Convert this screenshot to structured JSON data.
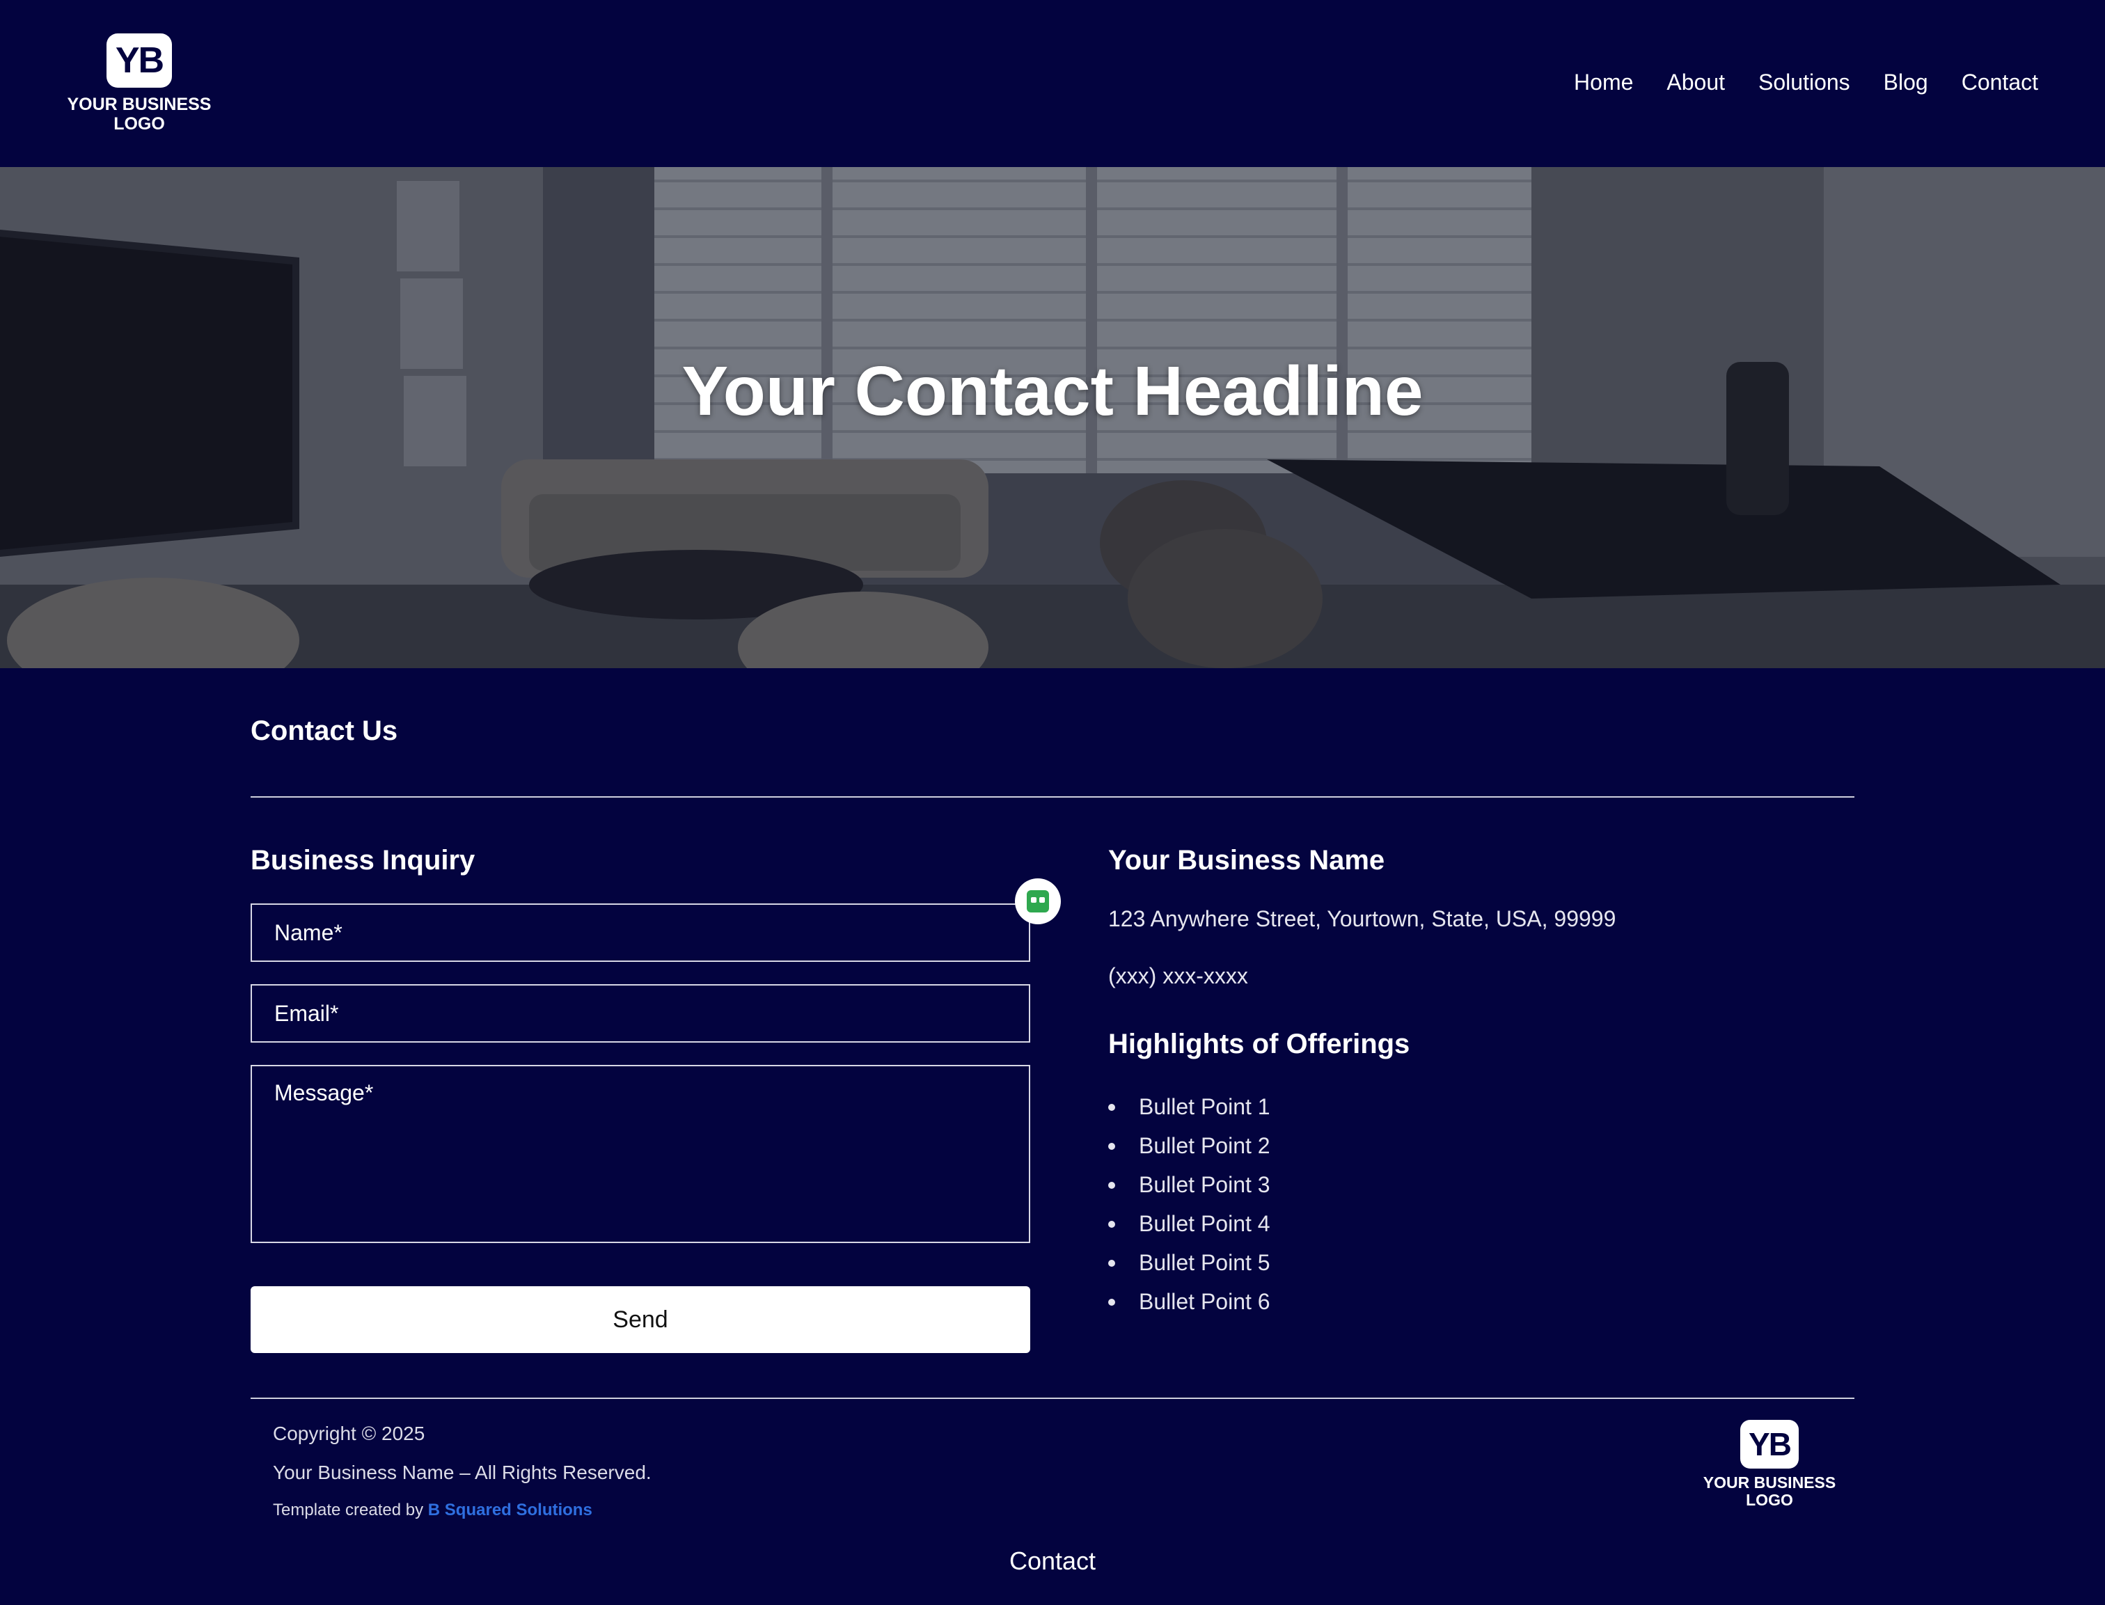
{
  "header": {
    "logo": {
      "mark": "YB",
      "text": "YOUR BUSINESS LOGO"
    },
    "nav": [
      "Home",
      "About",
      "Solutions",
      "Blog",
      "Contact"
    ]
  },
  "hero": {
    "headline": "Your Contact Headline"
  },
  "contact": {
    "section_title": "Contact Us",
    "form": {
      "title": "Business Inquiry",
      "name_placeholder": "Name*",
      "email_placeholder": "Email*",
      "message_placeholder": "Message*",
      "send_label": "Send"
    },
    "business": {
      "name": "Your Business Name",
      "address": "123 Anywhere Street, Yourtown, State, USA, 99999",
      "phone": "(xxx) xxx-xxxx",
      "highlights_title": "Highlights of Offerings",
      "bullets": [
        "Bullet Point 1",
        "Bullet Point 2",
        "Bullet Point 3",
        "Bullet Point 4",
        "Bullet Point 5",
        "Bullet Point 6"
      ]
    }
  },
  "footer": {
    "copyright": "Copyright © 2025",
    "rights": "Your Business Name – All Rights Reserved.",
    "credit_prefix": "Template created by",
    "credit_link": "B Squared Solutions",
    "logo": {
      "mark": "YB",
      "text": "YOUR BUSINESS LOGO"
    },
    "bottom_link": "Contact"
  },
  "colors": {
    "background": "#03033f",
    "link": "#2f6fe0",
    "badge": "#2fa84f"
  },
  "icons": {
    "recaptcha_badge": "robot-badge-icon"
  }
}
